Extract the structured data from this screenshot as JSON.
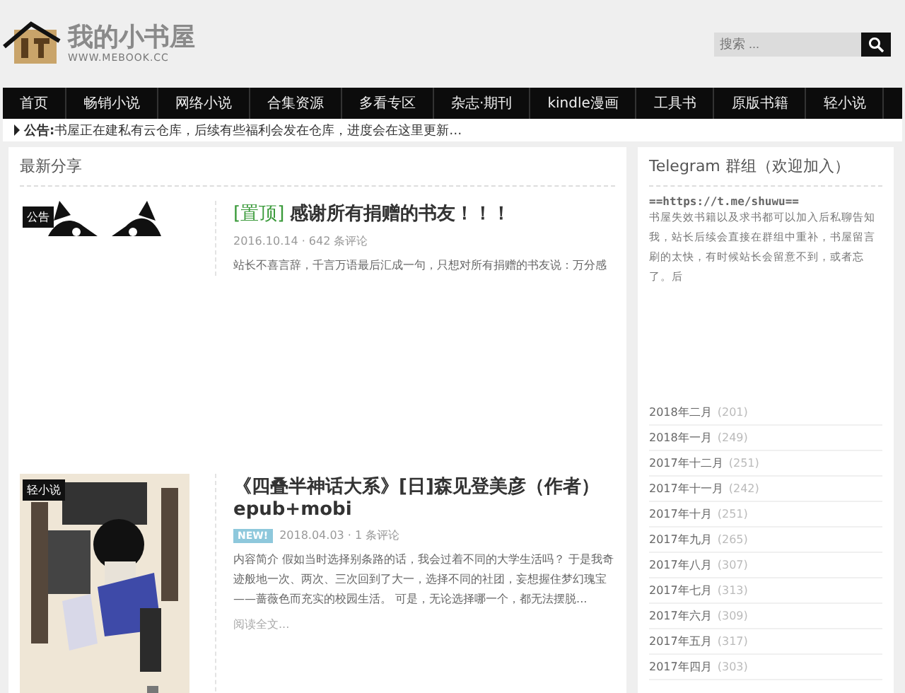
{
  "site": {
    "name": "我的小书屋",
    "url": "WWW.MEBOOK.CC"
  },
  "search": {
    "placeholder": "搜索 ..."
  },
  "nav": [
    "首页",
    "畅销小说",
    "网络小说",
    "合集资源",
    "多看专区",
    "杂志·期刊",
    "kindle漫画",
    "工具书",
    "原版书籍",
    "轻小说"
  ],
  "notice": "**公告:**书屋正在建私有云仓库，后续有些福利会发在仓库，进度会在这里更新…",
  "section_title": "最新分享",
  "posts": [
    {
      "category": "公告",
      "pin": "[置顶]",
      "title": "感谢所有捐赠的书友！！！",
      "meta": "2016.10.14 · 642 条评论",
      "excerpt": "站长不喜言辞，千言万语最后汇成一句，只想对所有捐赠的书友说：万分感"
    },
    {
      "category": "轻小说",
      "badge": "NEW!",
      "title": "《四叠半神话大系》[日]森见登美彦（作者） epub+mobi",
      "meta": "2018.04.03 · 1 条评论",
      "excerpt": "内容简介 假如当时选择别条路的话，我会过着不同的大学生活吗？ 于是我奇迹般地一次、两次、三次回到了大一，选择不同的社团，妄想握住梦幻瑰宝——蔷薇色而充实的校园生活。 可是，无论选择哪一个，都无法摆脱...",
      "more": "阅读全文..."
    }
  ],
  "sidebar": {
    "title": "Telegram 群组（欢迎加入）",
    "link": "==https://t.me/shuwu==",
    "text": "书屋失效书籍以及求书都可以加入后私聊告知我，站长后续会直接在群组中重补，书屋留言刷的太快，有时候站长会留意不到，或者忘了。后",
    "archive": [
      {
        "month": "2018年二月",
        "count": "(201)"
      },
      {
        "month": "2018年一月",
        "count": "(249)"
      },
      {
        "month": "2017年十二月",
        "count": "(251)"
      },
      {
        "month": "2017年十一月",
        "count": "(242)"
      },
      {
        "month": "2017年十月",
        "count": "(251)"
      },
      {
        "month": "2017年九月",
        "count": "(265)"
      },
      {
        "month": "2017年八月",
        "count": "(307)"
      },
      {
        "month": "2017年七月",
        "count": "(313)"
      },
      {
        "month": "2017年六月",
        "count": "(309)"
      },
      {
        "month": "2017年五月",
        "count": "(317)"
      },
      {
        "month": "2017年四月",
        "count": "(303)"
      }
    ]
  }
}
